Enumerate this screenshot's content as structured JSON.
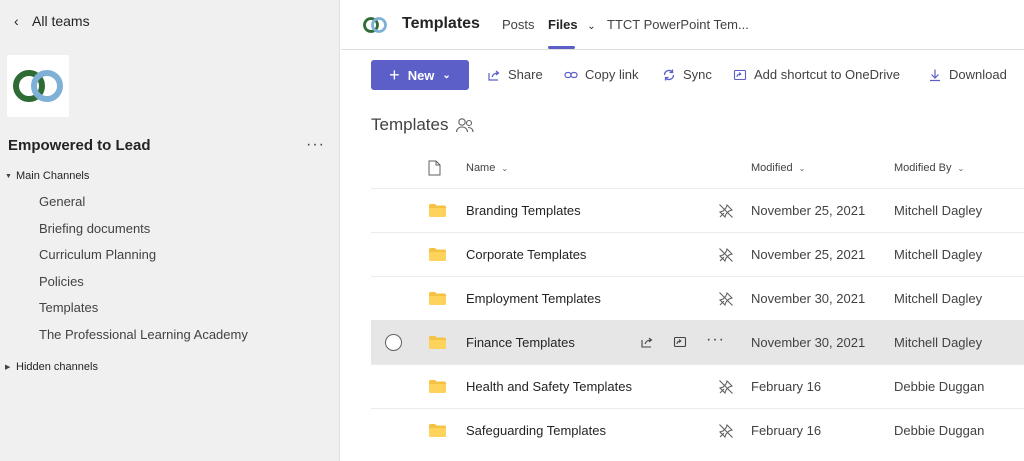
{
  "sidebar": {
    "back_label": "All teams",
    "team_name": "Empowered to Lead",
    "team_more": "···",
    "main_section": "Main Channels",
    "channels": [
      "General",
      "Briefing documents",
      "Curriculum Planning",
      "Policies",
      "Templates",
      "The Professional Learning Academy"
    ],
    "hidden_section": "Hidden channels"
  },
  "header": {
    "title": "Templates",
    "tabs": {
      "posts": "Posts",
      "files": "Files",
      "ttct": "TTCT PowerPoint Tem..."
    }
  },
  "toolbar": {
    "new_label": "New",
    "share_label": "Share",
    "copy_link_label": "Copy link",
    "sync_label": "Sync",
    "shortcut_label": "Add shortcut to OneDrive",
    "download_label": "Download"
  },
  "library": {
    "title": "Templates",
    "columns": {
      "name": "Name",
      "modified": "Modified",
      "modified_by": "Modified By"
    },
    "rows": [
      {
        "name": "Branding Templates",
        "modified": "November 25, 2021",
        "modified_by": "Mitchell Dagley"
      },
      {
        "name": "Corporate Templates",
        "modified": "November 25, 2021",
        "modified_by": "Mitchell Dagley"
      },
      {
        "name": "Employment Templates",
        "modified": "November 30, 2021",
        "modified_by": "Mitchell Dagley"
      },
      {
        "name": "Finance Templates",
        "modified": "November 30, 2021",
        "modified_by": "Mitchell Dagley"
      },
      {
        "name": "Health and Safety Templates",
        "modified": "February 16",
        "modified_by": "Debbie Duggan"
      },
      {
        "name": "Safeguarding Templates",
        "modified": "February 16",
        "modified_by": "Debbie Duggan"
      }
    ],
    "row_more": "···"
  },
  "icons": {
    "back": "chevron-left-icon",
    "folder": "folder-icon",
    "pin": "pin-off-icon",
    "people": "people-icon"
  },
  "colors": {
    "accent": "#5b5fc7",
    "folder": "#f5c242",
    "logo_green": "#2e6b35",
    "logo_blue": "#7fb1d6"
  }
}
